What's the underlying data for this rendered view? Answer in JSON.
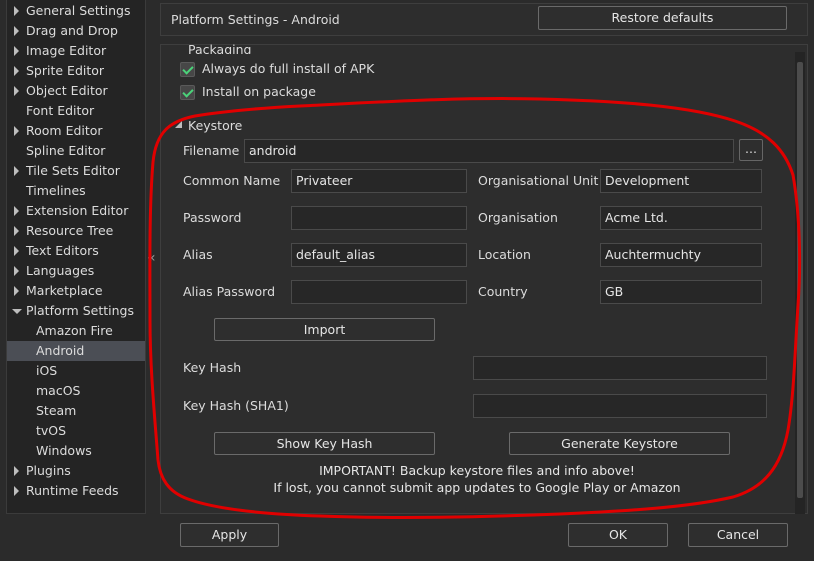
{
  "tree": {
    "items": [
      {
        "label": "General Settings",
        "expandable": true
      },
      {
        "label": "Drag and Drop",
        "expandable": true
      },
      {
        "label": "Image Editor",
        "expandable": true
      },
      {
        "label": "Sprite Editor",
        "expandable": true
      },
      {
        "label": "Object Editor",
        "expandable": true
      },
      {
        "label": "Font Editor",
        "expandable": false
      },
      {
        "label": "Room Editor",
        "expandable": true
      },
      {
        "label": "Spline Editor",
        "expandable": false
      },
      {
        "label": "Tile Sets Editor",
        "expandable": true
      },
      {
        "label": "Timelines",
        "expandable": false
      },
      {
        "label": "Extension Editor",
        "expandable": true
      },
      {
        "label": "Resource Tree",
        "expandable": true
      },
      {
        "label": "Text Editors",
        "expandable": true
      },
      {
        "label": "Languages",
        "expandable": true
      },
      {
        "label": "Marketplace",
        "expandable": true
      },
      {
        "label": "Platform Settings",
        "expandable": true,
        "expanded": true
      },
      {
        "label": "Amazon Fire",
        "child": true
      },
      {
        "label": "Android",
        "child": true,
        "selected": true
      },
      {
        "label": "iOS",
        "child": true
      },
      {
        "label": "macOS",
        "child": true
      },
      {
        "label": "Steam",
        "child": true
      },
      {
        "label": "tvOS",
        "child": true
      },
      {
        "label": "Windows",
        "child": true
      },
      {
        "label": "Plugins",
        "expandable": true
      },
      {
        "label": "Runtime Feeds",
        "expandable": true
      }
    ]
  },
  "header": {
    "title": "Platform Settings - Android",
    "restore_label": "Restore defaults"
  },
  "packaging": {
    "title": "Packaging",
    "options": [
      {
        "label": "Always do full install of APK",
        "checked": true
      },
      {
        "label": "Install on package",
        "checked": true
      }
    ]
  },
  "keystore": {
    "title": "Keystore",
    "filename_label": "Filename",
    "filename_value": "android",
    "browse_label": "...",
    "common_name_label": "Common Name",
    "common_name_value": "Privateer",
    "org_unit_label": "Organisational Unit",
    "org_unit_value": "Development",
    "password_label": "Password",
    "password_value": "",
    "organisation_label": "Organisation",
    "organisation_value": "Acme Ltd.",
    "alias_label": "Alias",
    "alias_value": "default_alias",
    "location_label": "Location",
    "location_value": "Auchtermuchty",
    "alias_password_label": "Alias Password",
    "alias_password_value": "",
    "country_label": "Country",
    "country_value": "GB",
    "import_label": "Import",
    "key_hash_label": "Key Hash",
    "key_hash_value": "",
    "key_hash_sha1_label": "Key Hash (SHA1)",
    "key_hash_sha1_value": "",
    "show_key_hash_label": "Show Key Hash",
    "generate_keystore_label": "Generate Keystore",
    "notice_line1": "IMPORTANT! Backup keystore files and info above!",
    "notice_line2": "If lost, you cannot submit app updates to Google Play or Amazon"
  },
  "footer": {
    "apply_label": "Apply",
    "ok_label": "OK",
    "cancel_label": "Cancel"
  },
  "colors": {
    "annotation": "#e00000",
    "check": "#4bd37a",
    "selected_bg": "#4b4e55"
  },
  "icons": {
    "collapse": "chevron-double-left-icon",
    "browse": "ellipsis-icon"
  }
}
